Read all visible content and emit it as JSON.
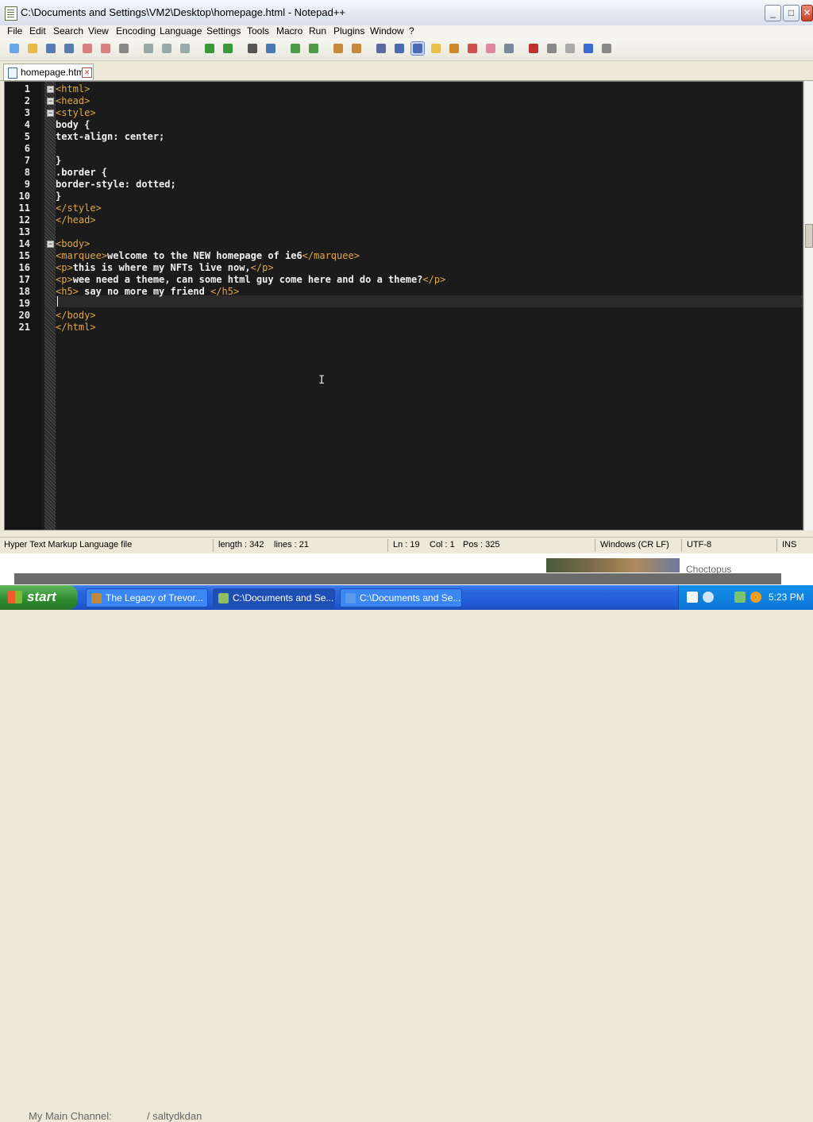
{
  "window": {
    "title": "C:\\Documents and Settings\\VM2\\Desktop\\homepage.html - Notepad++"
  },
  "menu": [
    "File",
    "Edit",
    "Search",
    "View",
    "Encoding",
    "Language",
    "Settings",
    "Tools",
    "Macro",
    "Run",
    "Plugins",
    "Window",
    "?"
  ],
  "toolbar_icons": [
    "new-file-icon",
    "open-file-icon",
    "save-icon",
    "save-all-icon",
    "close-icon",
    "close-all-icon",
    "print-icon",
    "cut-icon",
    "copy-icon",
    "paste-icon",
    "undo-icon",
    "redo-icon",
    "find-icon",
    "replace-icon",
    "zoom-in-icon",
    "zoom-out-icon",
    "sync-vertical-icon",
    "sync-horizontal-icon",
    "word-wrap-icon",
    "show-all-chars-icon",
    "indent-guide-icon",
    "user-lang-icon",
    "doc-map-icon",
    "function-list-icon",
    "folder-workspace-icon",
    "monitor-icon",
    "record-macro-icon",
    "stop-macro-icon",
    "play-macro-icon",
    "run-macro-multiple-icon",
    "save-macro-icon"
  ],
  "tab": {
    "label": "homepage.html"
  },
  "editor": {
    "line_numbers": [
      "1",
      "2",
      "3",
      "4",
      "5",
      "6",
      "7",
      "8",
      "9",
      "10",
      "11",
      "12",
      "13",
      "14",
      "15",
      "16",
      "17",
      "18",
      "19",
      "20",
      "21"
    ],
    "lines": [
      [
        {
          "t": "tag",
          "v": "<html>"
        }
      ],
      [
        {
          "t": "tag",
          "v": "<head>"
        }
      ],
      [
        {
          "t": "tag",
          "v": "<style>"
        }
      ],
      [
        {
          "t": "txt",
          "v": "body {"
        }
      ],
      [
        {
          "t": "txt",
          "v": "text-align: center;"
        }
      ],
      [],
      [
        {
          "t": "txt",
          "v": "}"
        }
      ],
      [
        {
          "t": "txt",
          "v": ".border {"
        }
      ],
      [
        {
          "t": "txt",
          "v": "border-style: dotted;"
        }
      ],
      [
        {
          "t": "txt",
          "v": "}"
        }
      ],
      [
        {
          "t": "tag",
          "v": "</style>"
        }
      ],
      [
        {
          "t": "tag",
          "v": "</head>"
        }
      ],
      [],
      [
        {
          "t": "tag",
          "v": "<body>"
        }
      ],
      [
        {
          "t": "tag",
          "v": "<marquee>"
        },
        {
          "t": "txt",
          "v": "welcome to the NEW homepage of ie6"
        },
        {
          "t": "tag",
          "v": "</marquee>"
        }
      ],
      [
        {
          "t": "tag",
          "v": "<p>"
        },
        {
          "t": "txt",
          "v": "this is where my NFTs live now,"
        },
        {
          "t": "tag",
          "v": "</p>"
        }
      ],
      [
        {
          "t": "tag",
          "v": "<p>"
        },
        {
          "t": "txt",
          "v": "wee need a theme, can some html guy come here and do a theme?"
        },
        {
          "t": "tag",
          "v": "</p>"
        }
      ],
      [
        {
          "t": "tag",
          "v": "<h5>"
        },
        {
          "t": "txt",
          "v": " say no more my friend "
        },
        {
          "t": "tag",
          "v": "</h5>"
        }
      ],
      [],
      [
        {
          "t": "tag",
          "v": "</body>"
        }
      ],
      [
        {
          "t": "tag",
          "v": "</html>"
        }
      ]
    ]
  },
  "status": {
    "file_type": "Hyper Text Markup Language file",
    "length": "length : 342",
    "lines": "lines : 21",
    "ln": "Ln : 19",
    "col": "Col : 1",
    "pos": "Pos : 325",
    "eol": "Windows (CR LF)",
    "encoding": "UTF-8",
    "mode": "INS"
  },
  "background": {
    "channel_text": "My Main Channel:",
    "handle_text": "/ saltydkdan",
    "thumb_label": "Choctopus"
  },
  "taskbar": {
    "start": "start",
    "tasks": [
      {
        "label": "The Legacy of Trevor...",
        "icon_color": "#c0893a"
      },
      {
        "label": "C:\\Documents and Se...",
        "icon_color": "#8fbf5a"
      },
      {
        "label": "C:\\Documents and Se...",
        "icon_color": "#5a9ae8"
      }
    ],
    "clock": "5:23 PM"
  }
}
